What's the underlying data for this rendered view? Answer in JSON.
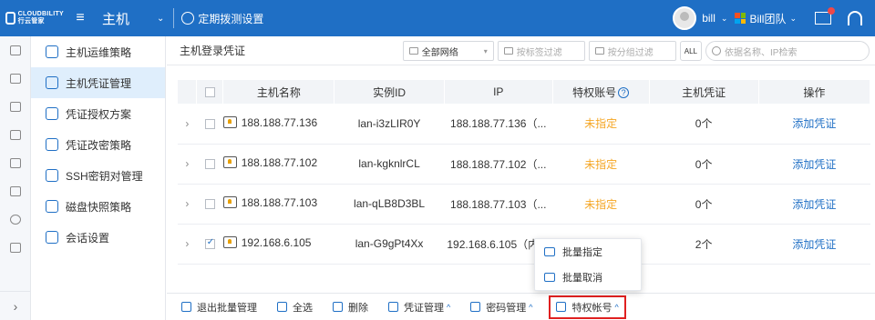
{
  "topbar": {
    "logo_text": "CLOUDBILITY",
    "logo_sub": "行云管家",
    "title": "主机",
    "task_label": "定期拨测设置",
    "user": "bill",
    "team": "Bill团队"
  },
  "rail_items": [
    "monitor",
    "topology",
    "docs",
    "clipboard",
    "book",
    "chart",
    "search",
    "check"
  ],
  "sidenav": {
    "items": [
      {
        "label": "主机运维策略"
      },
      {
        "label": "主机凭证管理"
      },
      {
        "label": "凭证授权方案"
      },
      {
        "label": "凭证改密策略"
      },
      {
        "label": "SSH密钥对管理"
      },
      {
        "label": "磁盘快照策略"
      },
      {
        "label": "会话设置"
      }
    ],
    "active_index": 1
  },
  "toolbar": {
    "title": "主机登录凭证",
    "network": "全部网络",
    "tag_filter": "按标签过滤",
    "group_filter": "按分组过滤",
    "all_btn": "ALL",
    "search_placeholder": "依据名称、IP检索"
  },
  "table": {
    "headers": {
      "name": "主机名称",
      "instance": "实例ID",
      "ip": "IP",
      "priv": "特权账号",
      "cred": "主机凭证",
      "op": "操作"
    },
    "rows": [
      {
        "name": "188.188.77.136",
        "instance": "lan-i3zLIR0Y",
        "ip": "188.188.77.136（...",
        "priv": "未指定",
        "cred": "0个",
        "op": "添加凭证",
        "checked": false
      },
      {
        "name": "188.188.77.102",
        "instance": "lan-kgknlrCL",
        "ip": "188.188.77.102（...",
        "priv": "未指定",
        "cred": "0个",
        "op": "添加凭证",
        "checked": false
      },
      {
        "name": "188.188.77.103",
        "instance": "lan-qLB8D3BL",
        "ip": "188.188.77.103（...",
        "priv": "未指定",
        "cred": "0个",
        "op": "添加凭证",
        "checked": false
      },
      {
        "name": "192.168.6.105",
        "instance": "lan-G9gPt4Xx",
        "ip": "192.168.6.105（内）",
        "priv": "",
        "cred": "2个",
        "op": "添加凭证",
        "checked": true
      }
    ]
  },
  "popup": {
    "items": [
      "批量指定",
      "批量取消"
    ]
  },
  "bottombar": {
    "exit": "退出批量管理",
    "select_all": "全选",
    "delete": "删除",
    "cred_mgmt": "凭证管理",
    "pwd_mgmt": "密码管理",
    "priv_account": "特权帐号"
  },
  "colors": {
    "brand": "#1f6fc5",
    "warning": "#f5a623",
    "highlight": "#e02020"
  }
}
